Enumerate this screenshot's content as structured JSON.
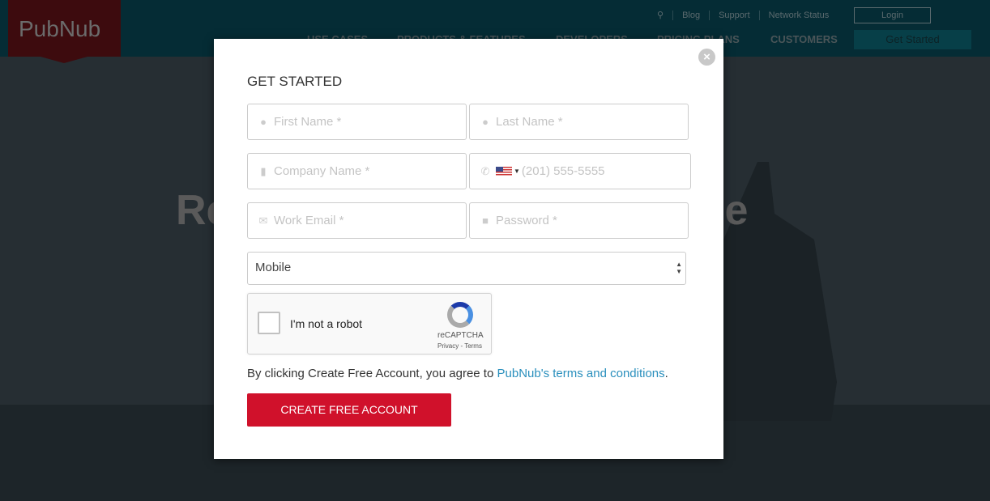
{
  "header": {
    "logo": "PubNub",
    "top_links": [
      "Blog",
      "Support",
      "Network Status"
    ],
    "login": "Login",
    "nav": [
      "USE CASES",
      "PRODUCTS & FEATURES",
      "DEVELOPERS",
      "PRICING PLANS",
      "CUSTOMERS"
    ],
    "get_started": "Get Started"
  },
  "hero": {
    "left_fragment": "Re",
    "right_fragment": "le"
  },
  "modal": {
    "title": "GET STARTED",
    "close_icon": "close-circle-icon",
    "fields": {
      "first_name": "First Name *",
      "last_name": "Last Name *",
      "company": "Company Name *",
      "phone": "(201) 555-5555",
      "email": "Work Email *",
      "password": "Password *"
    },
    "select_value": "Mobile",
    "captcha": {
      "label": "I'm not a robot",
      "brand": "reCAPTCHA",
      "links": "Privacy - Terms"
    },
    "agree_text": "By clicking Create Free Account, you agree to ",
    "agree_link": "PubNub's terms and conditions",
    "agree_end": ".",
    "submit": "CREATE FREE ACCOUNT"
  },
  "colors": {
    "accent": "#d0112b",
    "link": "#2a8fbd"
  }
}
